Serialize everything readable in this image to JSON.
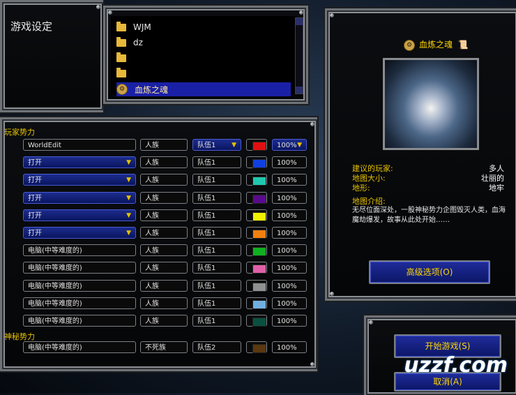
{
  "settings": {
    "title": "游戏设定"
  },
  "map_list": {
    "items": [
      {
        "type": "folder",
        "label": "WJM"
      },
      {
        "type": "folder",
        "label": "dz"
      },
      {
        "type": "folder",
        "label": ""
      },
      {
        "type": "folder",
        "label": ""
      },
      {
        "type": "map",
        "label": "血炼之魂",
        "selected": true
      }
    ]
  },
  "players": {
    "section_player": "玩家势力",
    "section_mystery": "神秘势力",
    "rows": [
      {
        "name": "WorldEdit",
        "name_dropdown": false,
        "race": "人族",
        "team": "队伍1",
        "team_dropdown": true,
        "color": "#e01010",
        "handicap": "100%",
        "handicap_dropdown": true
      },
      {
        "name": "打开",
        "name_dropdown": true,
        "race": "人族",
        "team": "队伍1",
        "team_dropdown": false,
        "color": "#1040e0",
        "handicap": "100%",
        "handicap_dropdown": false
      },
      {
        "name": "打开",
        "name_dropdown": true,
        "race": "人族",
        "team": "队伍1",
        "team_dropdown": false,
        "color": "#20c8b0",
        "handicap": "100%",
        "handicap_dropdown": false
      },
      {
        "name": "打开",
        "name_dropdown": true,
        "race": "人族",
        "team": "队伍1",
        "team_dropdown": false,
        "color": "#5a0a8c",
        "handicap": "100%",
        "handicap_dropdown": false
      },
      {
        "name": "打开",
        "name_dropdown": true,
        "race": "人族",
        "team": "队伍1",
        "team_dropdown": false,
        "color": "#f0f000",
        "handicap": "100%",
        "handicap_dropdown": false
      },
      {
        "name": "打开",
        "name_dropdown": true,
        "race": "人族",
        "team": "队伍1",
        "team_dropdown": false,
        "color": "#f08010",
        "handicap": "100%",
        "handicap_dropdown": false
      },
      {
        "name": "电脑(中等难度的)",
        "name_dropdown": false,
        "race": "人族",
        "team": "队伍1",
        "team_dropdown": false,
        "color": "#10b020",
        "handicap": "100%",
        "handicap_dropdown": false
      },
      {
        "name": "电脑(中等难度的)",
        "name_dropdown": false,
        "race": "人族",
        "team": "队伍1",
        "team_dropdown": false,
        "color": "#e060a8",
        "handicap": "100%",
        "handicap_dropdown": false
      },
      {
        "name": "电脑(中等难度的)",
        "name_dropdown": false,
        "race": "人族",
        "team": "队伍1",
        "team_dropdown": false,
        "color": "#909090",
        "handicap": "100%",
        "handicap_dropdown": false
      },
      {
        "name": "电脑(中等难度的)",
        "name_dropdown": false,
        "race": "人族",
        "team": "队伍1",
        "team_dropdown": false,
        "color": "#70b0e0",
        "handicap": "100%",
        "handicap_dropdown": false
      },
      {
        "name": "电脑(中等难度的)",
        "name_dropdown": false,
        "race": "人族",
        "team": "队伍1",
        "team_dropdown": false,
        "color": "#0a5040",
        "handicap": "100%",
        "handicap_dropdown": false
      }
    ],
    "mystery_rows": [
      {
        "name": "电脑(中等难度的)",
        "name_dropdown": false,
        "race": "不死族",
        "team": "队伍2",
        "team_dropdown": false,
        "color": "#5a3810",
        "handicap": "100%",
        "handicap_dropdown": false
      }
    ]
  },
  "map_info": {
    "title": "血炼之魂",
    "label_players": "建议的玩家:",
    "value_players": "多人",
    "label_size": "地图大小:",
    "value_size": "壮丽的",
    "label_terrain": "地形:",
    "value_terrain": "地牢",
    "label_desc": "地图介绍:",
    "desc": "无尽位面深处，一股神秘势力企图毁灭人类，血海魔劫爆发，故事从此处开始……"
  },
  "buttons": {
    "advanced": "高级选项(O)",
    "start": "开始游戏(S)",
    "cancel": "取消(A)"
  },
  "watermark": "uzzf.com"
}
